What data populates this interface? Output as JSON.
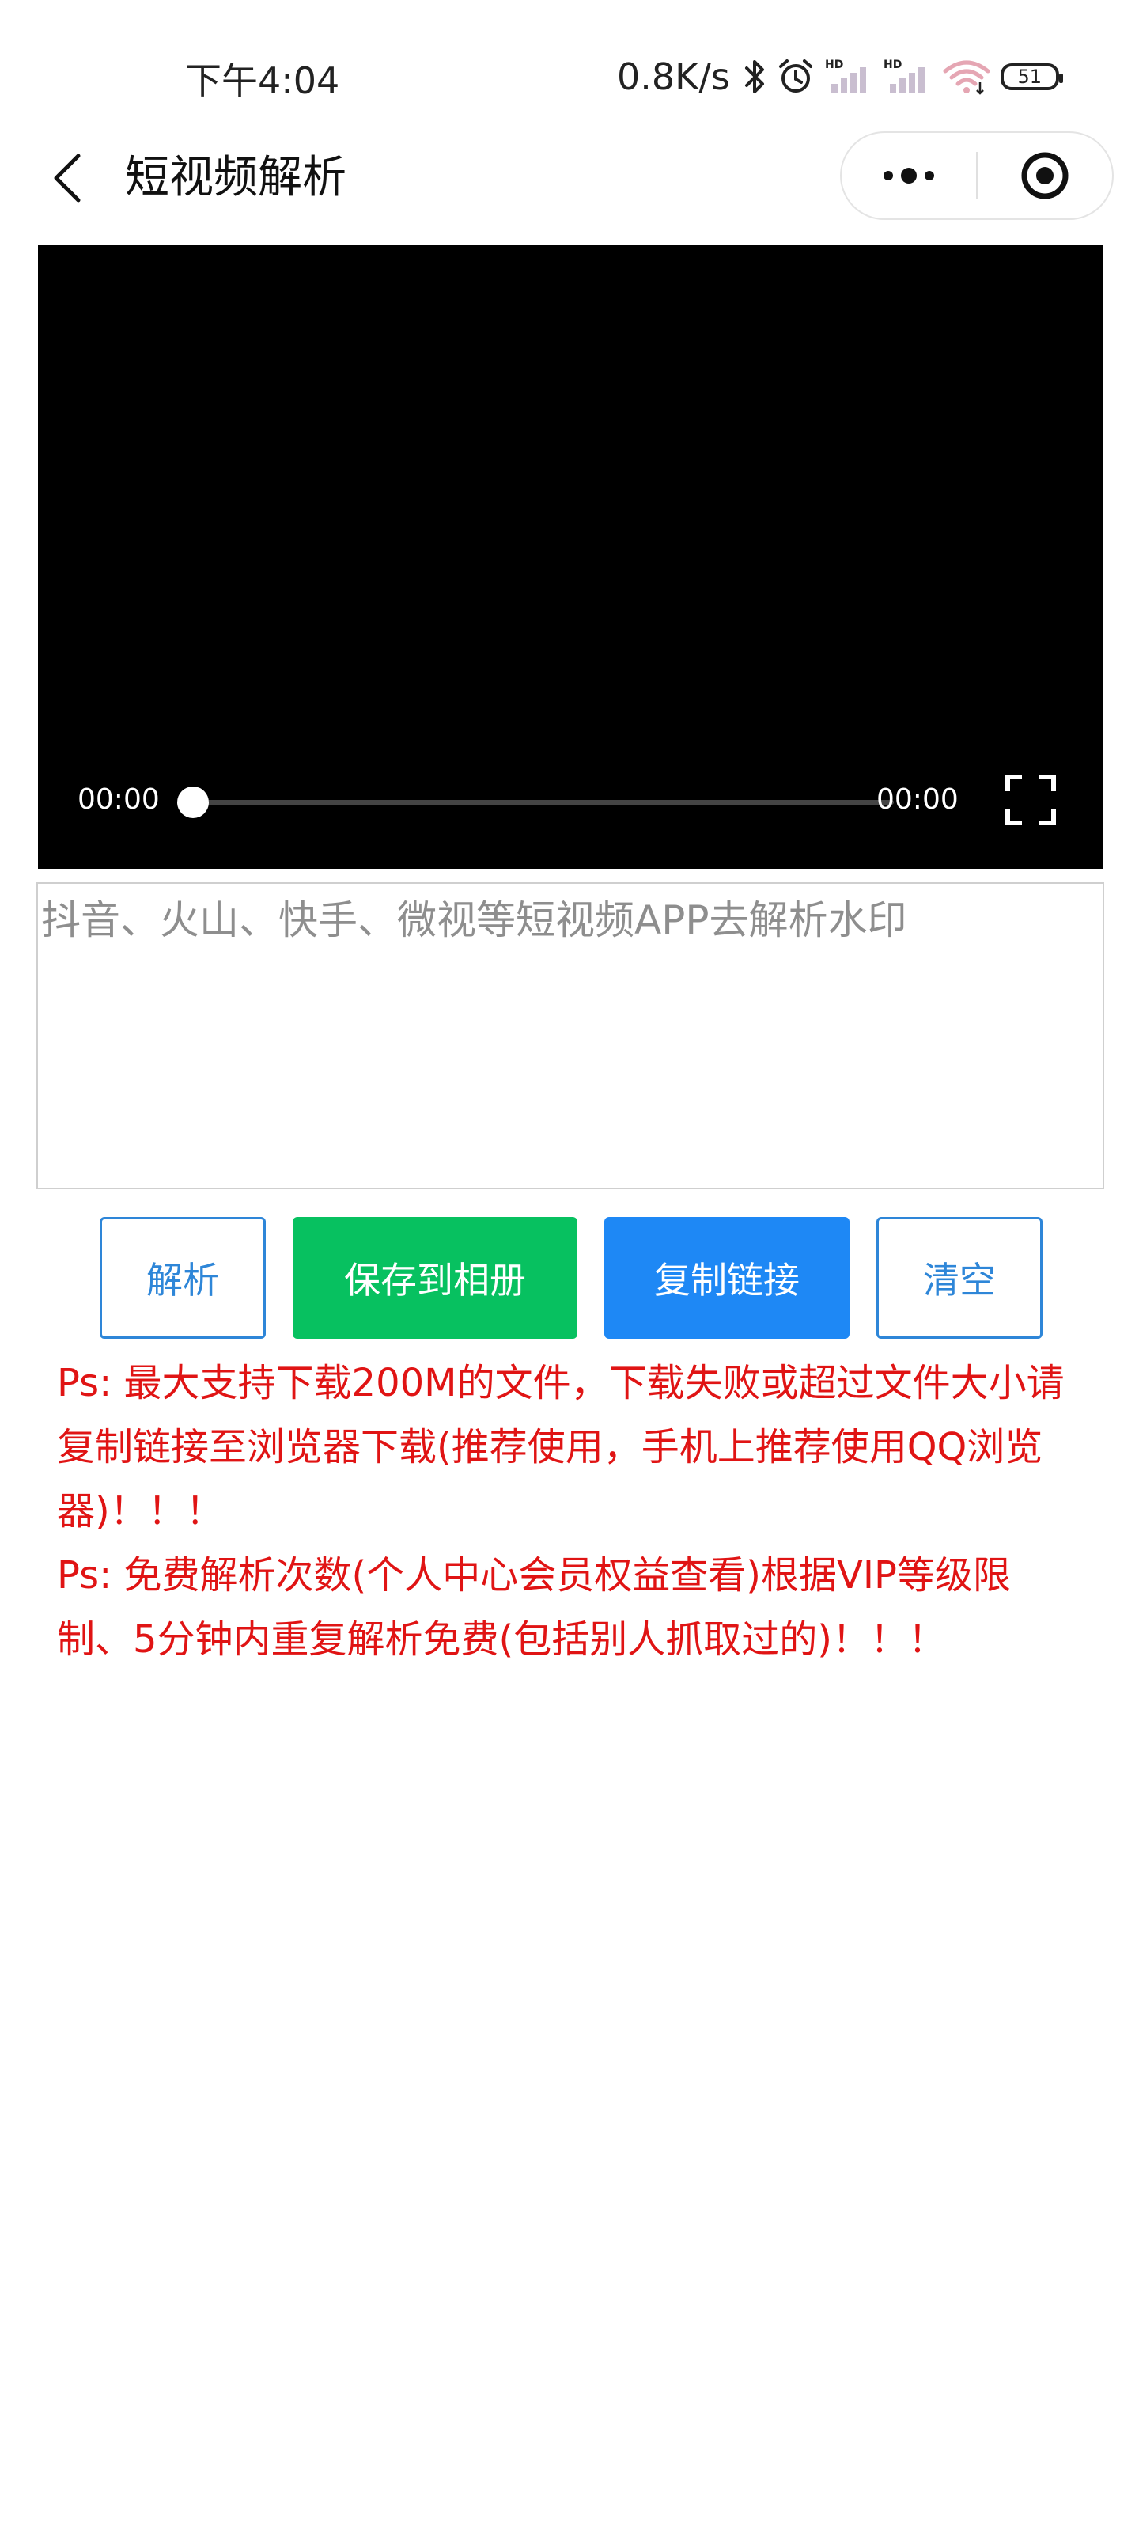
{
  "status_bar": {
    "time": "下午4:04",
    "net_speed": "0.8K/s",
    "battery": "51",
    "icons": [
      "bluetooth-icon",
      "alarm-icon",
      "signal-hd-icon",
      "signal-hd-icon",
      "wifi-icon",
      "battery-icon"
    ]
  },
  "nav": {
    "title": "短视频解析",
    "icons": [
      "back-arrow-icon",
      "more-dots-icon",
      "target-close-icon"
    ]
  },
  "video": {
    "current_time": "00:00",
    "total_time": "00:00",
    "progress": 0,
    "icons": [
      "fullscreen-icon"
    ]
  },
  "input": {
    "placeholder": "抖音、火山、快手、微视等短视频APP去解析水印",
    "value": ""
  },
  "buttons": {
    "parse": "解析",
    "save": "保存到相册",
    "copy": "复制链接",
    "clear": "清空"
  },
  "notes": {
    "note1": "Ps: 最大支持下载200M的文件，下载失败或超过文件大小请复制链接至浏览器下载(推荐使用，手机上推荐使用QQ浏览器)！！！",
    "note2": "Ps: 免费解析次数(个人中心会员权益查看)根据VIP等级限制、5分钟内重复解析免费(包括别人抓取过的)！！！"
  },
  "colors": {
    "save_button": "#07c160",
    "copy_button": "#1e88f5",
    "outline_button": "#2e86d8",
    "note_text": "#e01414",
    "video_bg": "#000000"
  }
}
